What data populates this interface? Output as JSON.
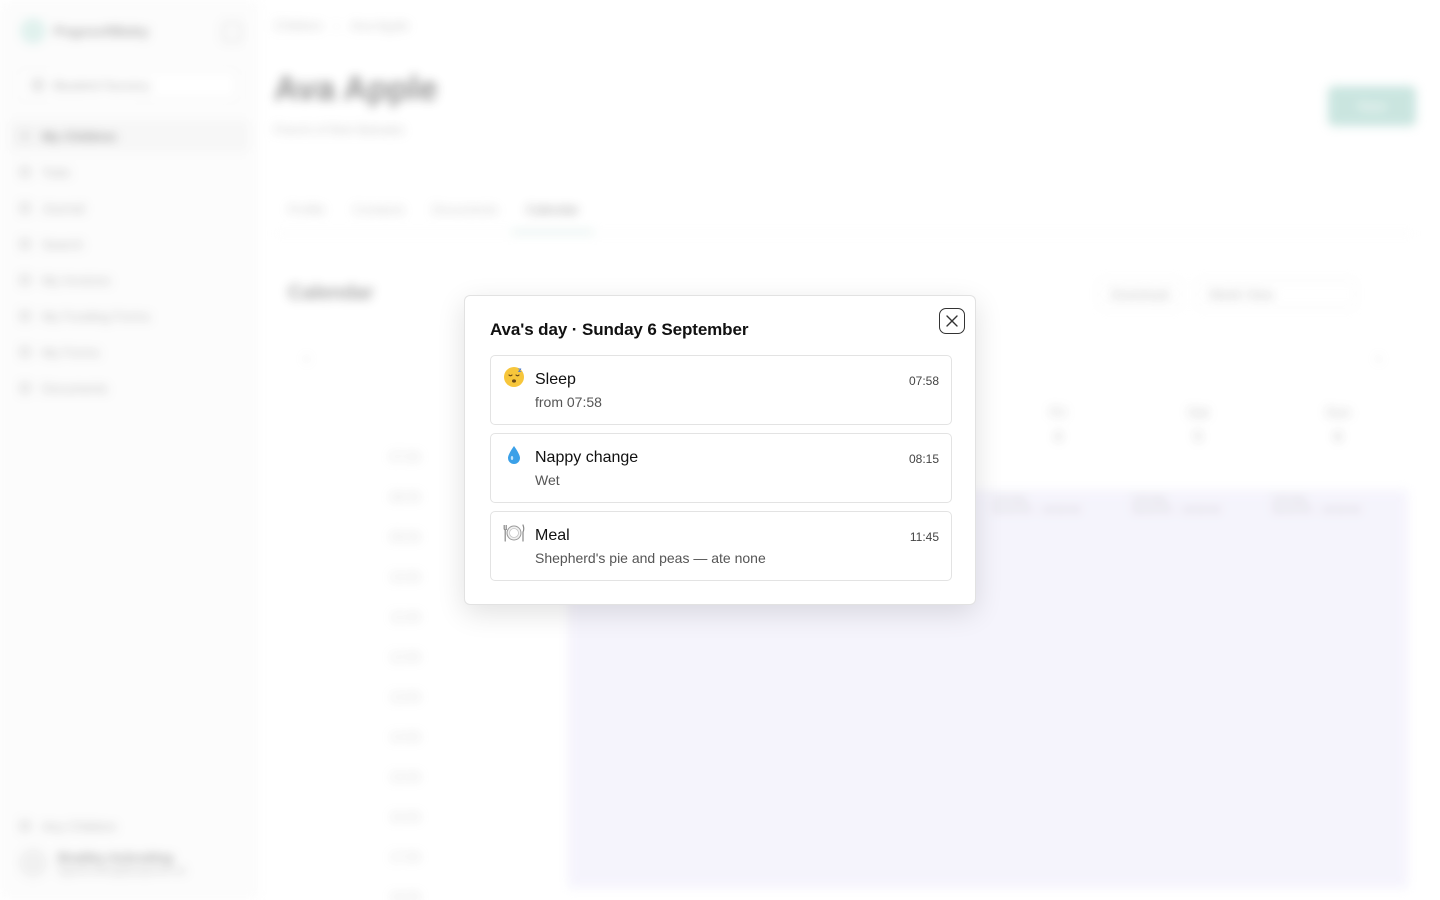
{
  "background": {
    "app_name": "PogosoftBaby",
    "nursery": "Bluebird Nursery",
    "nav": [
      {
        "label": "My Children",
        "active": true
      },
      {
        "label": "Todo",
        "active": false
      },
      {
        "label": "Journal",
        "active": false
      },
      {
        "label": "Search",
        "active": false
      },
      {
        "label": "My Invoices",
        "active": false
      },
      {
        "label": "My Funding Forms",
        "active": false
      },
      {
        "label": "My Forms",
        "active": false
      },
      {
        "label": "Documents",
        "active": false
      }
    ],
    "bottom_nav": "Any Children",
    "user": {
      "initials": "BA",
      "name": "Bradley Ackroding",
      "email": "bgackroding@pogosoft.uk"
    },
    "breadcrumbs": [
      "Children",
      "Ava Apple"
    ],
    "child_name": "Ava Apple",
    "child_subtitle": "Parent of Bob Baloabs",
    "new_button": "New",
    "tabs": [
      {
        "label": "Profile",
        "active": false
      },
      {
        "label": "Contacts",
        "active": false
      },
      {
        "label": "Documents",
        "active": false
      },
      {
        "label": "Calendar",
        "active": true
      }
    ],
    "calendar_title": "Calendar",
    "download_label": "Download",
    "view_select": "Week View",
    "days": [
      {
        "name": "Fri",
        "num": "4"
      },
      {
        "name": "Sat",
        "num": "5"
      },
      {
        "name": "Sun",
        "num": "6"
      }
    ],
    "times": [
      "07:00",
      "08:00",
      "09:00",
      "10:00",
      "11:00",
      "12:00",
      "13:00",
      "14:00",
      "15:00",
      "16:00",
      "17:00",
      "18:00"
    ],
    "fullday_label": "Full day",
    "fullday_range": "08:00:00 – 18:00:00"
  },
  "modal": {
    "title": "Ava's day · Sunday 6 September",
    "close_icon": "close-icon",
    "events": [
      {
        "icon": "sleep-emoji",
        "glyph": "😴",
        "name": "Sleep",
        "detail": "from 07:58",
        "time": "07:58"
      },
      {
        "icon": "water-drop-emoji",
        "glyph": "💧",
        "name": "Nappy change",
        "detail": "Wet",
        "time": "08:15"
      },
      {
        "icon": "plate-cutlery-emoji",
        "glyph": "🍽️",
        "name": "Meal",
        "detail": "Shepherd's pie and peas — ate none",
        "time": "11:45"
      }
    ]
  },
  "colors": {
    "accent": "#8fc9bd",
    "calendar_fill": "#ece9fb"
  }
}
